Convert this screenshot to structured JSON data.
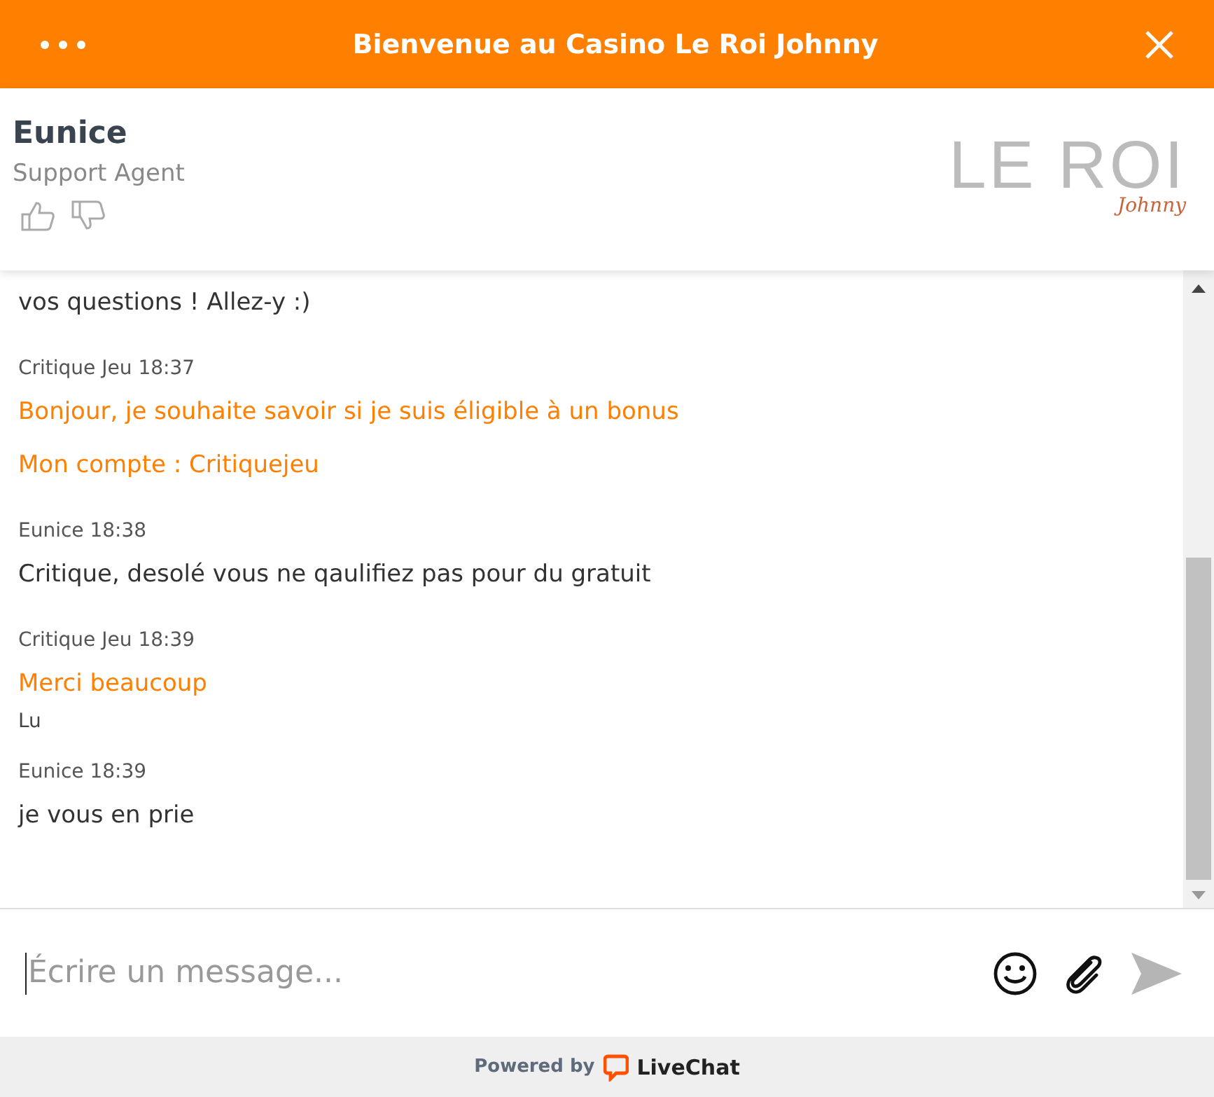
{
  "window": {
    "title": "Bienvenue au Casino Le Roi Johnny"
  },
  "agent": {
    "name": "Eunice",
    "role": "Support Agent"
  },
  "logo": {
    "main": "LE ROI",
    "script": "Johnny"
  },
  "messages": [
    {
      "kind": "agent",
      "lines": [
        "vos questions ! Allez-y :)"
      ]
    },
    {
      "kind": "visitor",
      "author": "Critique Jeu",
      "time": "18:37",
      "lines": [
        "Bonjour, je souhaite savoir si je suis éligible à un bonus",
        "Mon compte : Critiquejeu"
      ]
    },
    {
      "kind": "agent",
      "author": "Eunice",
      "time": "18:38",
      "lines": [
        "Critique, desolé vous ne qaulifiez pas pour du gratuit"
      ]
    },
    {
      "kind": "visitor",
      "author": "Critique Jeu",
      "time": "18:39",
      "lines": [
        "Merci beaucoup"
      ],
      "status": "Lu"
    },
    {
      "kind": "agent",
      "author": "Eunice",
      "time": "18:39",
      "lines": [
        "je vous en prie"
      ]
    }
  ],
  "composer": {
    "placeholder": "Écrire un message..."
  },
  "footer": {
    "prefix": "Powered by",
    "brand": "LiveChat"
  }
}
